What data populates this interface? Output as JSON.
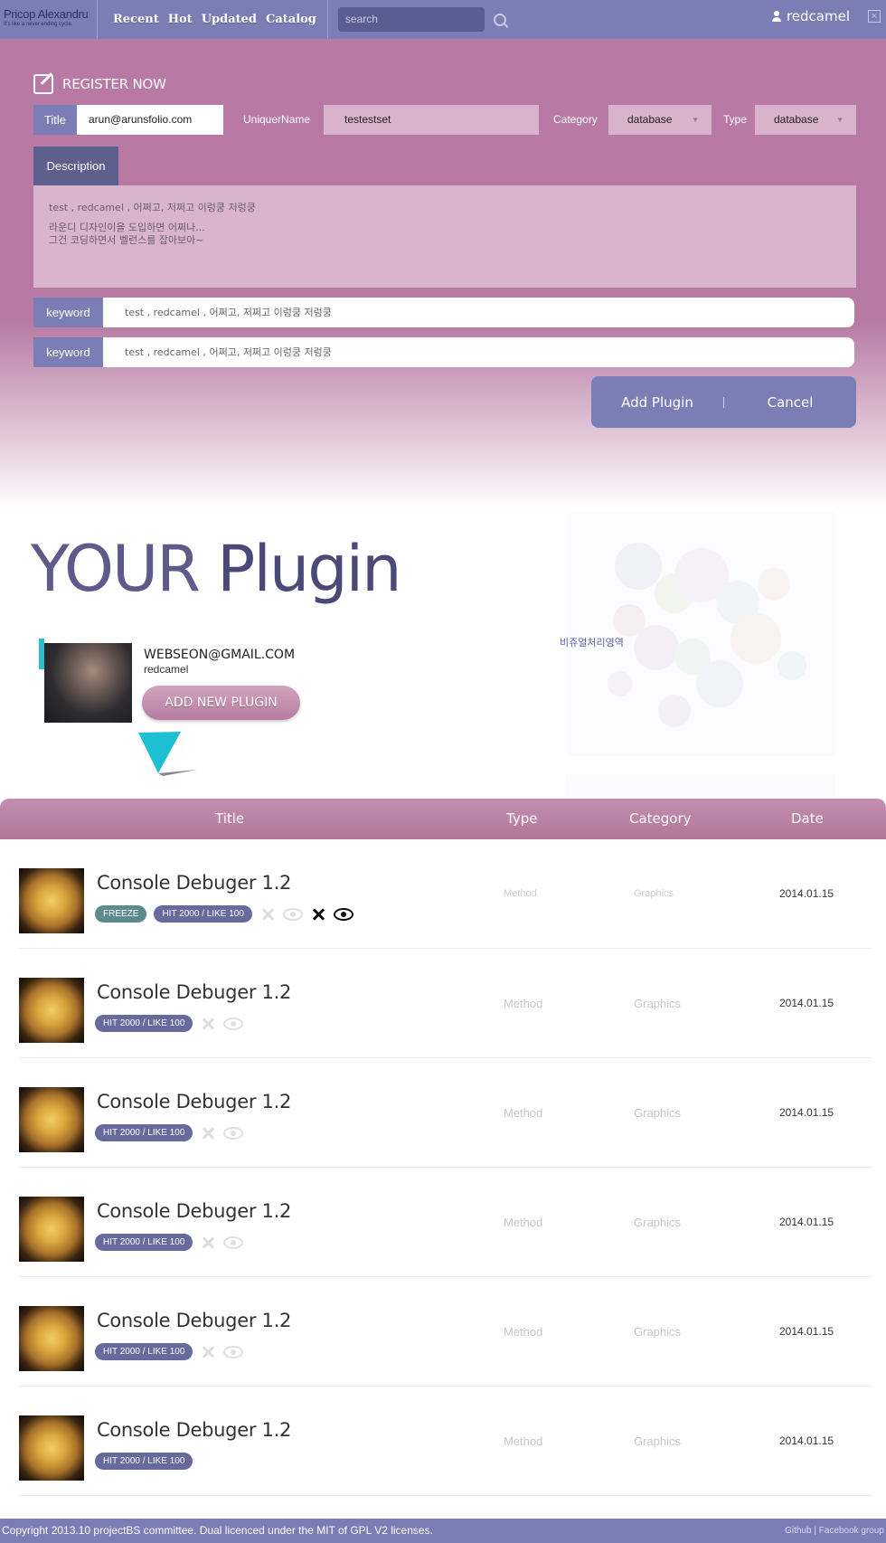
{
  "header": {
    "brand_name": "Pricop Alexandru",
    "brand_tagline": "It's like a never ending cycle.",
    "nav": [
      "Recent",
      "Hot",
      "Updated",
      "Catalog"
    ],
    "search_placeholder": "search",
    "username": "redcamel"
  },
  "register": {
    "heading": "REGISTER NOW",
    "title_label": "Title",
    "title_value": "arun@arunsfolio.com",
    "unique_label": "UniquerName",
    "unique_value": "testestset",
    "category_label": "Category",
    "category_value": "database",
    "type_label": "Type",
    "type_value": "database",
    "description_tab": "Description",
    "description_lines": [
      "test , redcamel , 어쩌고, 저쩌고 이렁쿵 저렁쿵",
      "라운디 디자인이을 도입하면 어쩌나...",
      "그건 코딩하면서 벨런스를 잡아보아~"
    ],
    "keywords": [
      {
        "label": "keyword",
        "value": "test , redcamel , 어쩌고, 저쩌고 이렁쿵 저렁쿵"
      },
      {
        "label": "keyword",
        "value": "test , redcamel , 어쩌고, 저쩌고 이렁쿵 저렁쿵"
      }
    ],
    "add_button": "Add Plugin",
    "cancel_button": "Cancel"
  },
  "profile": {
    "section_title_1": "YOUR",
    "section_title_2": "Plugin",
    "email": "WEBSEON@GMAIL.COM",
    "username": "redcamel",
    "add_new_button": "ADD NEW PLUGIN",
    "visual_label": "비쥬얼처리영역"
  },
  "table": {
    "headers": {
      "title": "Title",
      "type": "Type",
      "category": "Category",
      "date": "Date"
    },
    "rows": [
      {
        "title": "Console Debuger 1.2",
        "freeze": "FREEZE",
        "hit": "HIT 2000 / LIKE 100",
        "type": "Method",
        "category": "Graphics",
        "date": "2014.01.15"
      },
      {
        "title": "Console Debuger 1.2",
        "hit": "HIT 2000 / LIKE 100",
        "type": "Method",
        "category": "Graphics",
        "date": "2014.01.15"
      },
      {
        "title": "Console Debuger 1.2",
        "hit": "HIT 2000 / LIKE 100",
        "type": "Method",
        "category": "Graphics",
        "date": "2014.01.15"
      },
      {
        "title": "Console Debuger 1.2",
        "hit": "HIT 2000 / LIKE 100",
        "type": "Method",
        "category": "Graphics",
        "date": "2014.01.15"
      },
      {
        "title": "Console Debuger 1.2",
        "hit": "HIT 2000 / LIKE 100",
        "type": "Method",
        "category": "Graphics",
        "date": "2014.01.15"
      },
      {
        "title": "Console Debuger 1.2",
        "hit": "HIT 2000 / LIKE 100",
        "type": "Method",
        "category": "Graphics",
        "date": "2014.01.15"
      }
    ]
  },
  "footer": {
    "copyright": "Copyright 2013.10 projectBS committee. Dual licenced under the MIT of GPL V2 licenses.",
    "link_github": "Github",
    "separator": "|",
    "link_facebook": "Facebook group"
  },
  "colors": {
    "accent": "#7a7eb5",
    "pink": "#b87aa4",
    "dark_tab": "#5d5f8c"
  }
}
